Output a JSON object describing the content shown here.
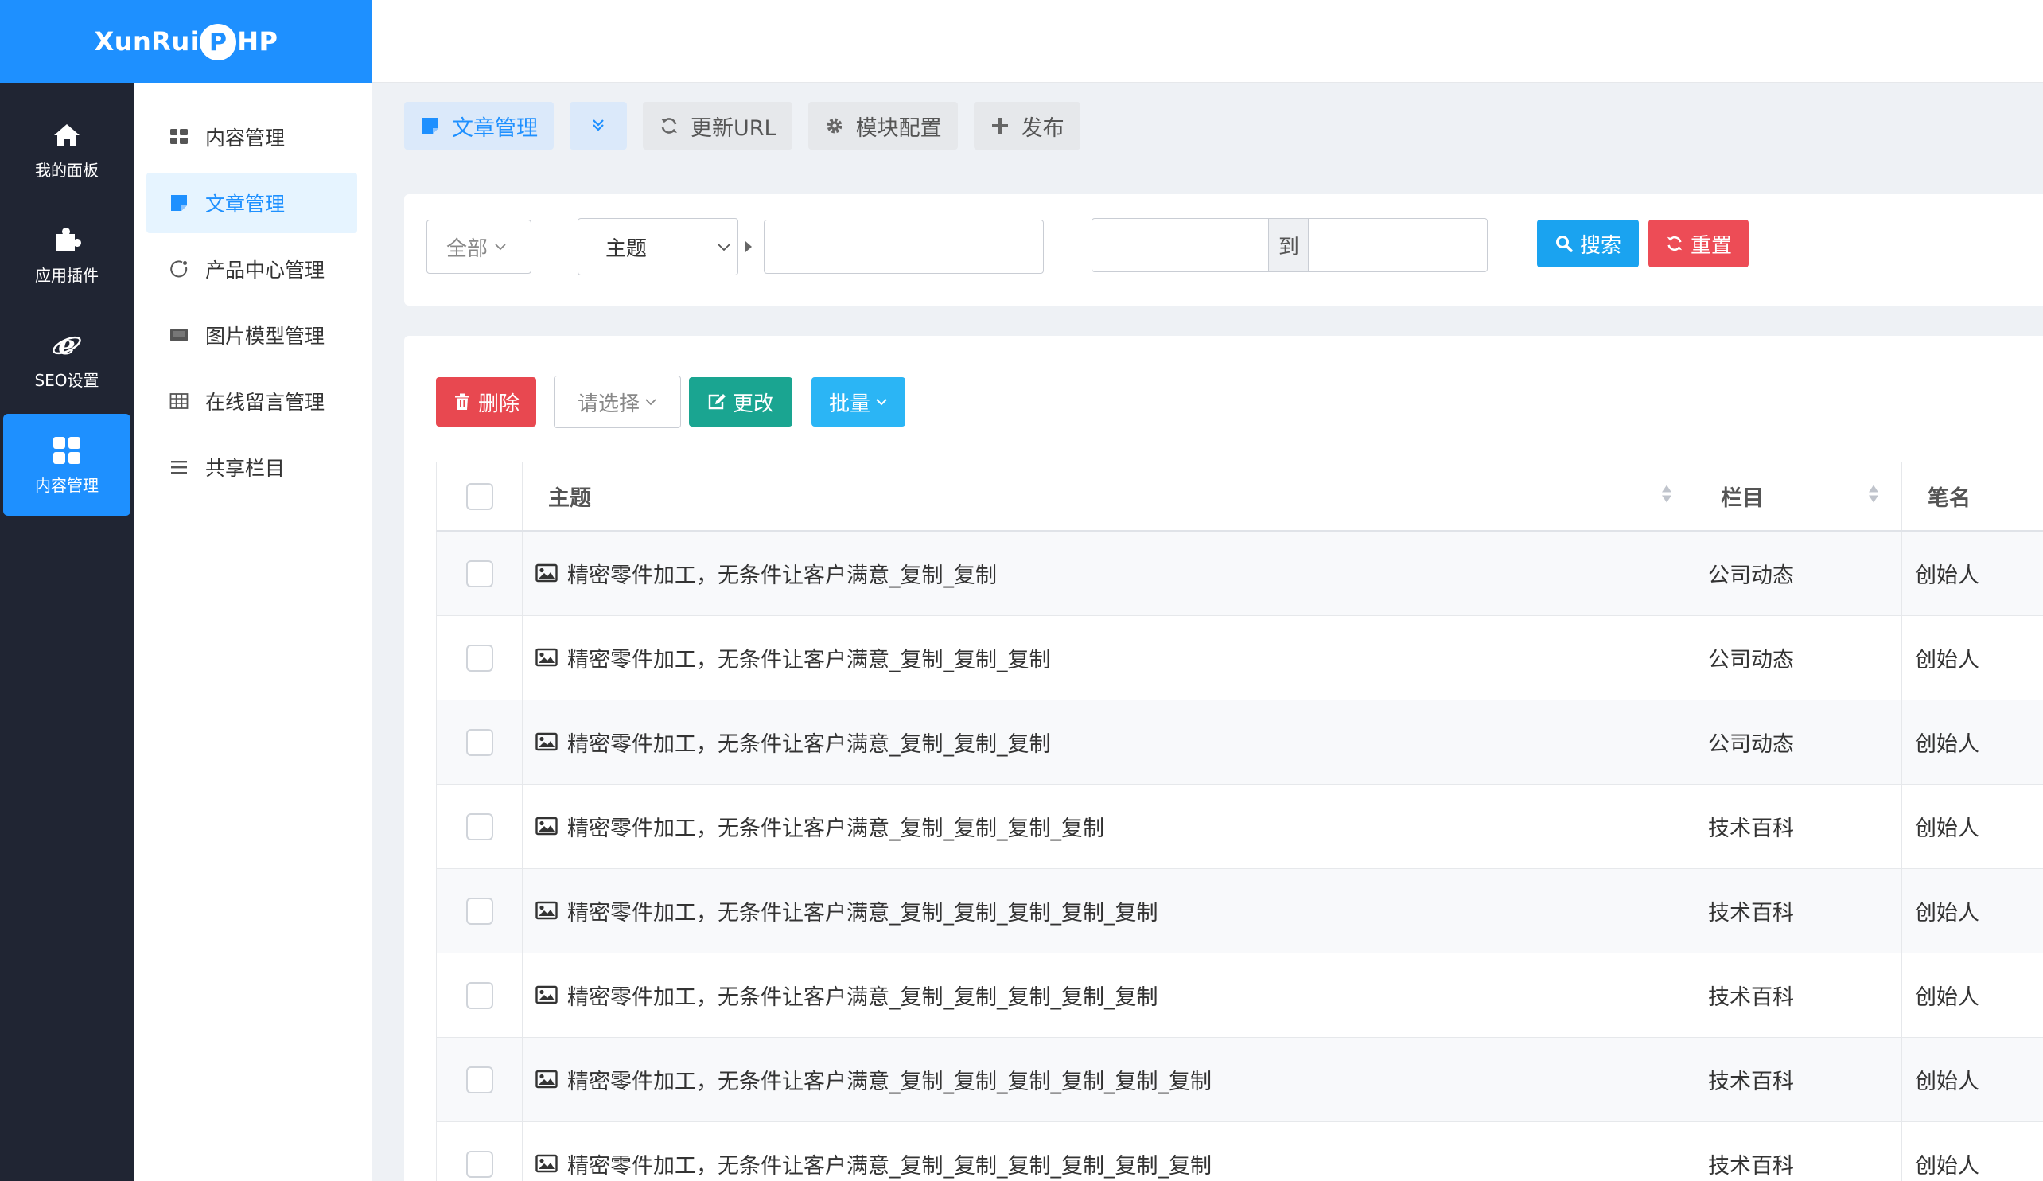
{
  "brand": {
    "logo_left": "XunRui",
    "logo_mid": "P",
    "logo_right": "HP"
  },
  "nav": {
    "items": [
      {
        "label": "我的面板",
        "icon": "home-icon"
      },
      {
        "label": "应用插件",
        "icon": "puzzle-icon"
      },
      {
        "label": "SEO设置",
        "icon": "ie-icon"
      },
      {
        "label": "内容管理",
        "icon": "grid-icon",
        "active": true
      }
    ]
  },
  "sidebar": {
    "items": [
      {
        "label": "内容管理",
        "icon": "grid-small-icon"
      },
      {
        "label": "文章管理",
        "icon": "sticky-note-icon",
        "active": true
      },
      {
        "label": "产品中心管理",
        "icon": "circle-notch-icon"
      },
      {
        "label": "图片模型管理",
        "icon": "image-card-icon"
      },
      {
        "label": "在线留言管理",
        "icon": "table-icon"
      },
      {
        "label": "共享栏目",
        "icon": "bars-icon"
      }
    ]
  },
  "toolbar": {
    "article_label": "文章管理",
    "update_url_label": "更新URL",
    "module_config_label": "模块配置",
    "publish_label": "发布"
  },
  "search": {
    "scope_value": "全部",
    "field_value": "主题",
    "keyword_value": "",
    "date_from_value": "",
    "to_label": "到",
    "date_to_value": "",
    "search_label": "搜索",
    "reset_label": "重置"
  },
  "actions": {
    "delete_label": "删除",
    "select_label": "请选择",
    "change_label": "更改",
    "batch_label": "批量"
  },
  "table": {
    "headers": {
      "title": "主题",
      "category": "栏目",
      "author": "笔名"
    },
    "rows": [
      {
        "title": "精密零件加工，无条件让客户满意_复制_复制",
        "category": "公司动态",
        "author": "创始人"
      },
      {
        "title": "精密零件加工，无条件让客户满意_复制_复制_复制",
        "category": "公司动态",
        "author": "创始人"
      },
      {
        "title": "精密零件加工，无条件让客户满意_复制_复制_复制",
        "category": "公司动态",
        "author": "创始人"
      },
      {
        "title": "精密零件加工，无条件让客户满意_复制_复制_复制_复制",
        "category": "技术百科",
        "author": "创始人"
      },
      {
        "title": "精密零件加工，无条件让客户满意_复制_复制_复制_复制_复制",
        "category": "技术百科",
        "author": "创始人"
      },
      {
        "title": "精密零件加工，无条件让客户满意_复制_复制_复制_复制_复制",
        "category": "技术百科",
        "author": "创始人"
      },
      {
        "title": "精密零件加工，无条件让客户满意_复制_复制_复制_复制_复制_复制",
        "category": "技术百科",
        "author": "创始人"
      },
      {
        "title": "精密零件加工，无条件让客户满意_复制_复制_复制_复制_复制_复制",
        "category": "技术百科",
        "author": "创始人"
      }
    ]
  },
  "colors": {
    "brand_blue": "#1e90ff",
    "sidebar_dark": "#202533",
    "search_btn": "#1aa3f0",
    "reset_btn": "#ed4c56",
    "delete_btn": "#e84850",
    "change_btn": "#1aa591",
    "batch_btn": "#2bb5f5"
  }
}
